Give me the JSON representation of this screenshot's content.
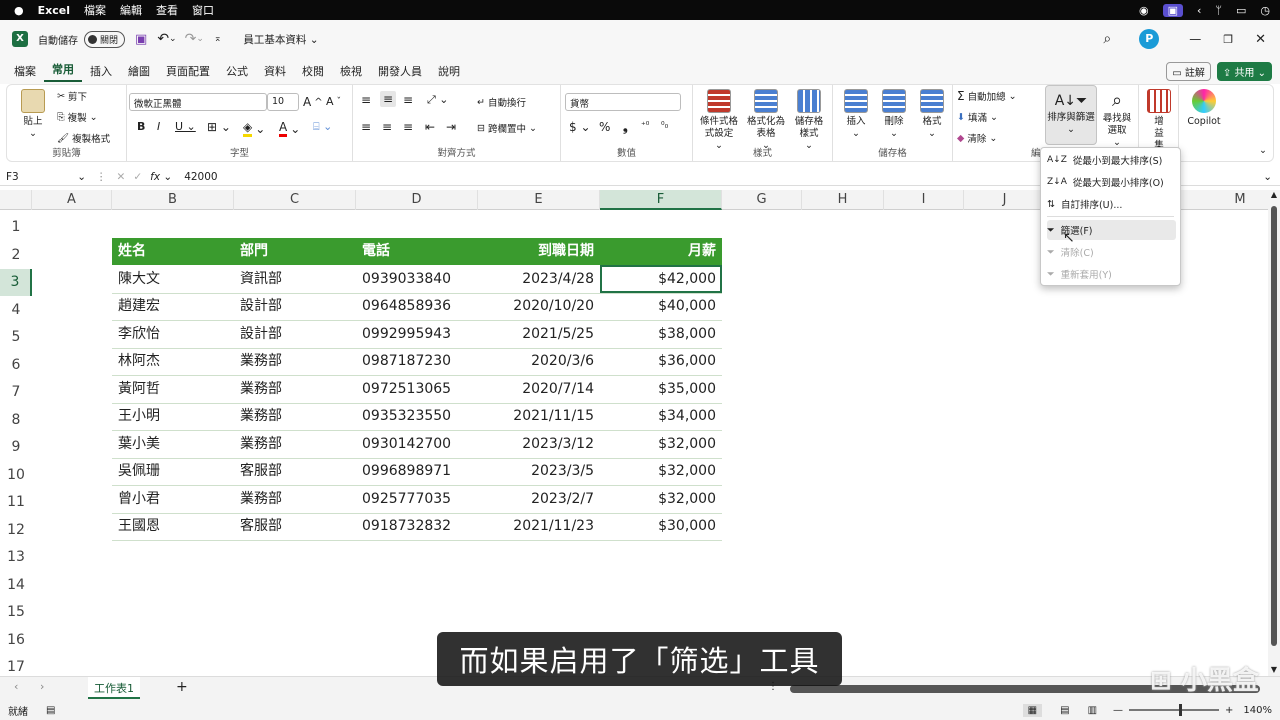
{
  "macbar": {
    "app": "Excel",
    "menus": [
      "檔案",
      "編輯",
      "查看",
      "窗口"
    ]
  },
  "titlebar": {
    "autosave_label": "自動儲存",
    "autosave_state": "關閉",
    "doc_title": "員工基本資料",
    "undo_arrow": "⌄"
  },
  "tabs": [
    "檔案",
    "常用",
    "插入",
    "繪圖",
    "頁面配置",
    "公式",
    "資料",
    "校閱",
    "檢視",
    "開發人員",
    "說明"
  ],
  "active_tab": "常用",
  "share": {
    "comment": "註解",
    "share": "共用"
  },
  "ribbon": {
    "clipboard": {
      "label": "剪貼簿",
      "paste": "貼上",
      "cut": "剪下",
      "copy": "複製",
      "format_painter": "複製格式"
    },
    "font": {
      "label": "字型",
      "name": "微軟正黑體",
      "size": "10"
    },
    "alignment": {
      "label": "對齊方式",
      "wrap": "自動換行",
      "merge": "跨欄置中"
    },
    "number": {
      "label": "數值",
      "format": "貨幣"
    },
    "styles": {
      "label": "樣式",
      "cond": "條件式格式設定",
      "table": "格式化為表格",
      "cell": "儲存格樣式"
    },
    "cells": {
      "label": "儲存格",
      "insert": "插入",
      "delete": "刪除",
      "format": "格式"
    },
    "editing": {
      "label": "編",
      "autosum": "自動加總",
      "fill": "填滿",
      "clear": "清除",
      "sort": "排序與篩選",
      "find": "尋找與選取"
    },
    "addins": {
      "label": "增益集"
    },
    "copilot": "Copilot"
  },
  "formula": {
    "namebox": "F3",
    "fx": "fx",
    "value": "42000"
  },
  "columns": [
    "A",
    "B",
    "C",
    "D",
    "E",
    "F",
    "G",
    "H",
    "I",
    "J",
    "M"
  ],
  "rows": [
    "1",
    "2",
    "3",
    "4",
    "5",
    "6",
    "7",
    "8",
    "9",
    "10",
    "11",
    "12",
    "13",
    "14",
    "15",
    "16",
    "17"
  ],
  "table": {
    "headers": [
      "姓名",
      "部門",
      "電話",
      "到職日期",
      "月薪"
    ],
    "rows": [
      [
        "陳大文",
        "資訊部",
        "0939033840",
        "2023/4/28",
        "$42,000"
      ],
      [
        "趙建宏",
        "設計部",
        "0964858936",
        "2020/10/20",
        "$40,000"
      ],
      [
        "李欣怡",
        "設計部",
        "0992995943",
        "2021/5/25",
        "$38,000"
      ],
      [
        "林阿杰",
        "業務部",
        "0987187230",
        "2020/3/6",
        "$36,000"
      ],
      [
        "黃阿哲",
        "業務部",
        "0972513065",
        "2020/7/14",
        "$35,000"
      ],
      [
        "王小明",
        "業務部",
        "0935323550",
        "2021/11/15",
        "$34,000"
      ],
      [
        "葉小美",
        "業務部",
        "0930142700",
        "2023/3/12",
        "$32,000"
      ],
      [
        "吳佩珊",
        "客服部",
        "0996898971",
        "2023/3/5",
        "$32,000"
      ],
      [
        "曾小君",
        "業務部",
        "0925777035",
        "2023/2/7",
        "$32,000"
      ],
      [
        "王國恩",
        "客服部",
        "0918732832",
        "2021/11/23",
        "$30,000"
      ]
    ]
  },
  "dropdown": [
    {
      "label": "從最小到最大排序(S)",
      "enabled": true
    },
    {
      "label": "從最大到最小排序(O)",
      "enabled": true
    },
    {
      "label": "自訂排序(U)...",
      "enabled": true
    },
    {
      "label": "篩選(F)",
      "enabled": true
    },
    {
      "label": "清除(C)",
      "enabled": false
    },
    {
      "label": "重新套用(Y)",
      "enabled": false
    }
  ],
  "sheet": {
    "name": "工作表1",
    "add": "+"
  },
  "status": {
    "ready": "就緒",
    "zoom": "140%"
  },
  "subtitle": "而如果启用了「筛选」工具",
  "watermark": "小黑盒",
  "colors": {
    "header_green": "#3a9b2e",
    "excel_green": "#185c37",
    "active_cell": "#217346"
  }
}
